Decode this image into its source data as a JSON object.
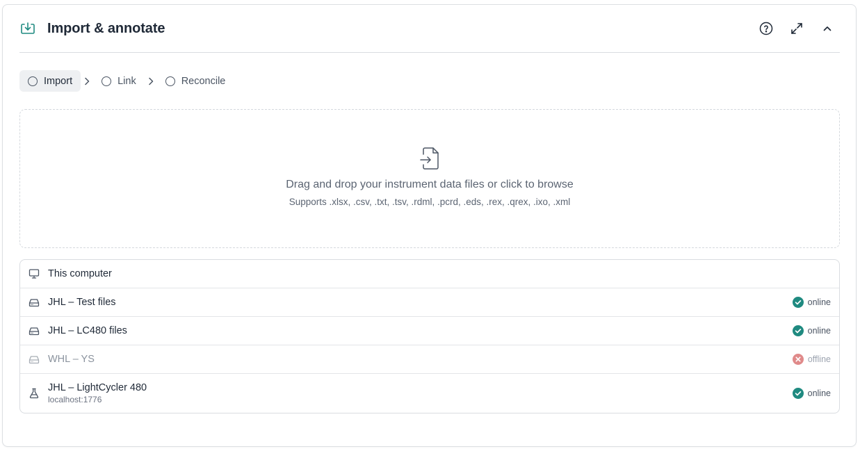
{
  "header": {
    "title": "Import & annotate",
    "icons": [
      "import-download-icon",
      "help-circle-icon",
      "expand-icon",
      "chevron-up-icon"
    ],
    "accent_color": "#1f8a80"
  },
  "steps": [
    {
      "label": "Import",
      "active": true
    },
    {
      "label": "Link",
      "active": false
    },
    {
      "label": "Reconcile",
      "active": false
    }
  ],
  "dropzone": {
    "title": "Drag and drop your instrument data files or click to browse",
    "subtitle": "Supports .xlsx, .csv, .txt, .tsv, .rdml, .pcrd, .eds, .rex, .qrex, .ixo, .xml",
    "icon": "file-import-icon"
  },
  "sources": [
    {
      "name": "This computer",
      "icon": "monitor-icon",
      "status": ""
    },
    {
      "name": "JHL – Test files",
      "icon": "drive-icon",
      "status": "online"
    },
    {
      "name": "JHL – LC480 files",
      "icon": "drive-icon",
      "status": "online"
    },
    {
      "name": "WHL – YS",
      "icon": "drive-icon",
      "status": "offline"
    },
    {
      "name": "JHL – LightCycler 480",
      "sub": "localhost:1776",
      "icon": "flask-icon",
      "status": "online"
    }
  ],
  "colors": {
    "online": "#1f8a80",
    "offline": "#e08a8a"
  }
}
